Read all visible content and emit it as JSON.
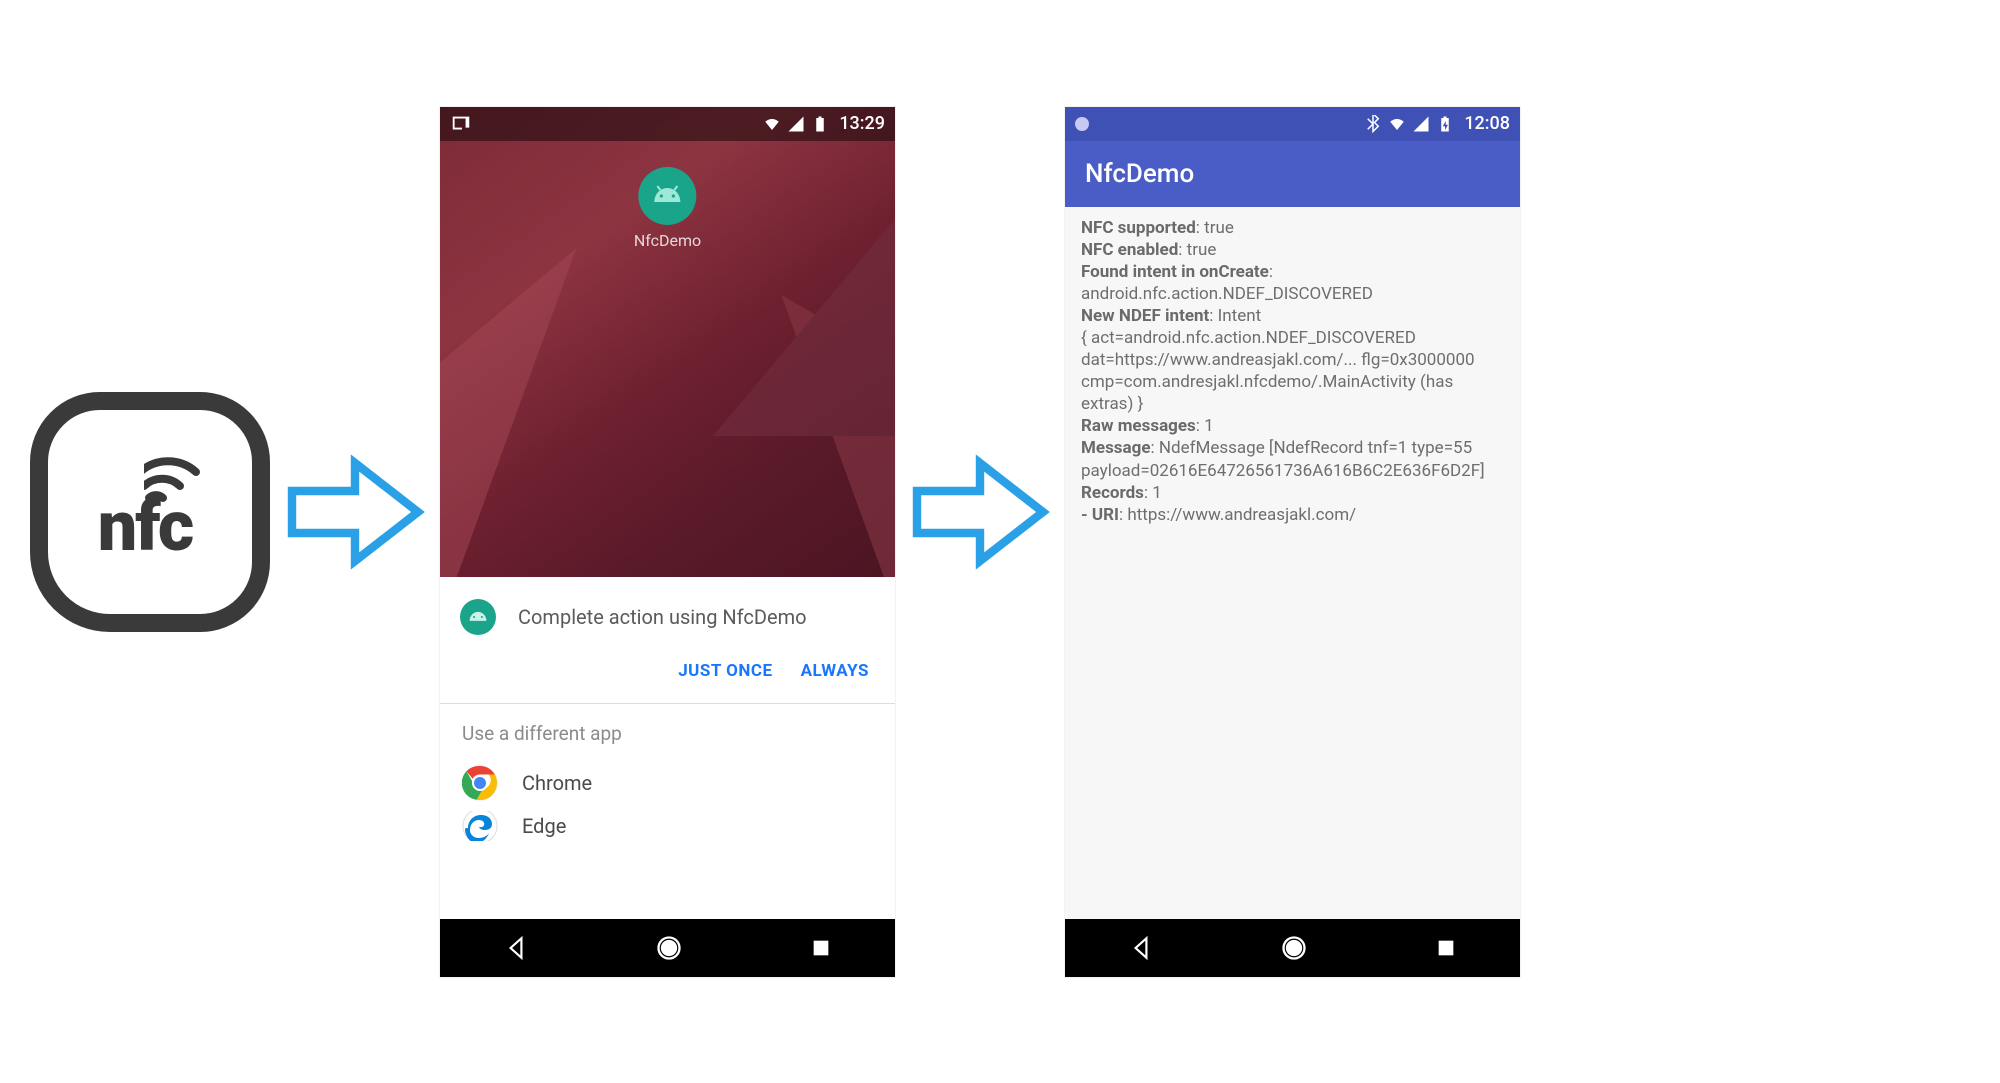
{
  "nfc": {
    "label": "nfc"
  },
  "phone1": {
    "statusbar": {
      "time": "13:29"
    },
    "app_icon_label": "NfcDemo",
    "action_title": "Complete action using NfcDemo",
    "btn_just_once": "JUST ONCE",
    "btn_always": "ALWAYS",
    "diff_label": "Use a different app",
    "alt_apps": [
      {
        "name": "Chrome"
      },
      {
        "name": "Edge"
      }
    ]
  },
  "phone2": {
    "statusbar": {
      "time": "12:08"
    },
    "appbar_title": "NfcDemo",
    "lines": {
      "l1b": "NFC supported",
      "l1v": ": true",
      "l2b": "NFC enabled",
      "l2v": ": true",
      "l3b": "Found intent in onCreate",
      "l3v": ":",
      "l4": "android.nfc.action.NDEF_DISCOVERED",
      "l5b": "New NDEF intent",
      "l5v": ": Intent",
      "l6": "{ act=android.nfc.action.NDEF_DISCOVERED dat=https://www.andreasjakl.com/... flg=0x3000000 cmp=com.andresjakl.nfcdemo/.MainActivity (has extras) }",
      "l7b": "Raw messages",
      "l7v": ": 1",
      "l8b": "Message",
      "l8v": ": NdefMessage [NdefRecord tnf=1 type=55 payload=02616E64726561736A616B6C2E636F6D2F]",
      "l9b": "Records",
      "l9v": ": 1",
      "l10b": "- URI",
      "l10v": ": https://www.andreasjakl.com/"
    }
  }
}
